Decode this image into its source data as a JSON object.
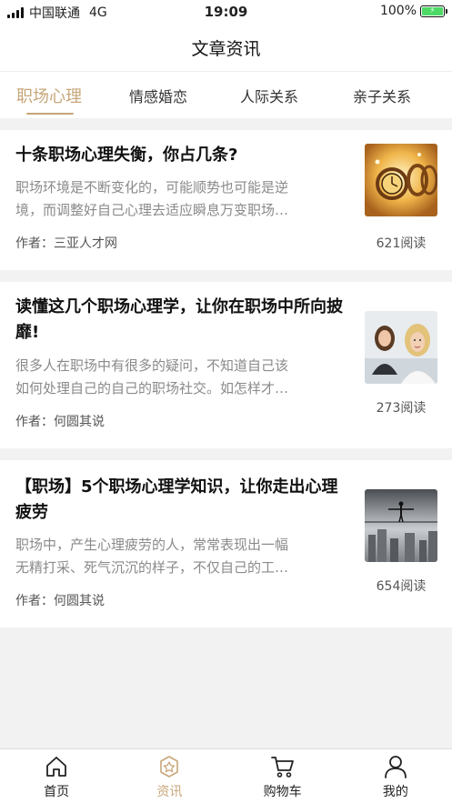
{
  "status_bar": {
    "carrier": "中国联通",
    "network": "4G",
    "time": "19:09",
    "battery": "100%",
    "battery_color": "#4cd964"
  },
  "header": {
    "title": "文章资讯"
  },
  "tabs": [
    {
      "label": "职场心理",
      "active": true
    },
    {
      "label": "情感婚恋",
      "active": false
    },
    {
      "label": "人际关系",
      "active": false
    },
    {
      "label": "亲子关系",
      "active": false
    }
  ],
  "accent_color": "#c7a679",
  "articles": [
    {
      "title_lines": [
        "十条职场心理失衡，你占几条?"
      ],
      "summary_lines": [
        "职场环境是不断变化的，可能顺势也可能是逆",
        "境，而调整好自己心理去适应瞬息万变职场…"
      ],
      "author": "作者：三亚人才网",
      "reads": "621阅读",
      "thumb_icon": "clock-thumbnail"
    },
    {
      "title_lines": [
        "读懂这几个职场心理学，让你在职场中所向披",
        "靡!"
      ],
      "summary_lines": [
        "很多人在职场中有很多的疑问，不知道自己该",
        "如何处理自己的自己的职场社交。如怎样才…"
      ],
      "author": "作者：何圆其说",
      "reads": "273阅读",
      "thumb_icon": "women-thumbnail"
    },
    {
      "title_lines": [
        "【职场】5个职场心理学知识，让你走出心理",
        "疲劳"
      ],
      "summary_lines": [
        "职场中，产生心理疲劳的人，常常表现出一幅",
        "无精打采、死气沉沉的样子，不仅自己的工…"
      ],
      "author": "作者：何圆其说",
      "reads": "654阅读",
      "thumb_icon": "tightrope-thumbnail"
    }
  ],
  "tabbar": [
    {
      "label": "首页",
      "icon": "home-icon",
      "active": false
    },
    {
      "label": "资讯",
      "icon": "news-icon",
      "active": true
    },
    {
      "label": "购物车",
      "icon": "cart-icon",
      "active": false
    },
    {
      "label": "我的",
      "icon": "profile-icon",
      "active": false
    }
  ]
}
